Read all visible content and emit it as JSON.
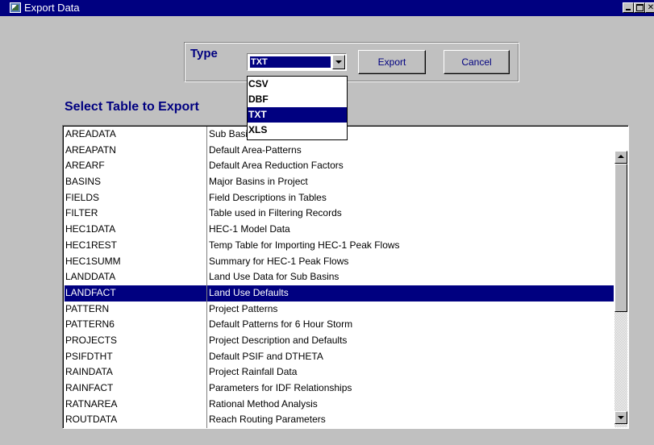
{
  "window": {
    "title": "Export Data",
    "icon": "export-data-app-icon",
    "controls": [
      "minimize-icon",
      "maximize-icon",
      "close-icon"
    ]
  },
  "type_group": {
    "label": "Type",
    "selected": "TXT",
    "options": [
      "CSV",
      "DBF",
      "TXT",
      "XLS"
    ],
    "dropdown_open": true
  },
  "buttons": {
    "export": "Export",
    "cancel": "Cancel"
  },
  "table_section": {
    "heading": "Select Table to Export",
    "selected_row": "LANDFACT",
    "rows": [
      {
        "name": "AREADATA",
        "desc": "Sub Basin Data"
      },
      {
        "name": "AREAPATN",
        "desc": "Default Area-Patterns"
      },
      {
        "name": "AREARF",
        "desc": "Default Area Reduction Factors"
      },
      {
        "name": "BASINS",
        "desc": "Major Basins in Project"
      },
      {
        "name": "FIELDS",
        "desc": "Field Descriptions in Tables"
      },
      {
        "name": "FILTER",
        "desc": "Table used in Filtering Records"
      },
      {
        "name": "HEC1DATA",
        "desc": "HEC-1 Model Data"
      },
      {
        "name": "HEC1REST",
        "desc": "Temp Table for Importing HEC-1 Peak Flows"
      },
      {
        "name": "HEC1SUMM",
        "desc": "Summary for HEC-1 Peak Flows"
      },
      {
        "name": "LANDDATA",
        "desc": "Land Use Data for Sub Basins"
      },
      {
        "name": "LANDFACT",
        "desc": "Land Use Defaults"
      },
      {
        "name": "PATTERN",
        "desc": "Project Patterns"
      },
      {
        "name": "PATTERN6",
        "desc": "Default Patterns for 6 Hour Storm"
      },
      {
        "name": "PROJECTS",
        "desc": "Project Description and Defaults"
      },
      {
        "name": "PSIFDTHT",
        "desc": "Default PSIF and DTHETA"
      },
      {
        "name": "RAINDATA",
        "desc": "Project Rainfall Data"
      },
      {
        "name": "RAINFACT",
        "desc": "Parameters for IDF Relationships"
      },
      {
        "name": "RATNAREA",
        "desc": "Rational Method Analysis"
      },
      {
        "name": "ROUTDATA",
        "desc": "Reach Routing Parameters"
      }
    ]
  },
  "colors": {
    "title_bar": "#000080",
    "label_text": "#000080",
    "selection": "#000080",
    "face": "#c0c0c0"
  }
}
